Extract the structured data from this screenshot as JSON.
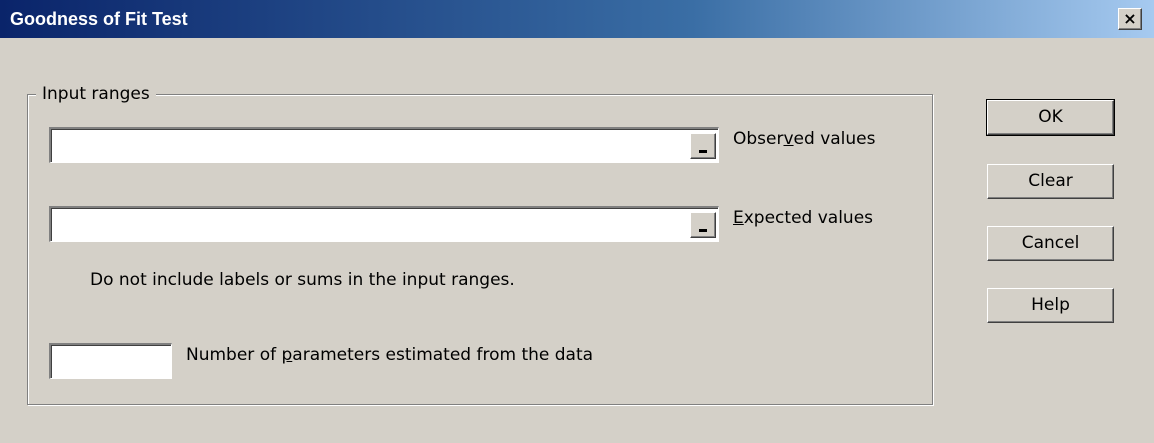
{
  "window": {
    "title": "Goodness of Fit Test",
    "close_label": "×"
  },
  "group": {
    "label": "Input ranges"
  },
  "observed": {
    "value": "",
    "label_pre": "Obser",
    "label_accel": "v",
    "label_post": "ed values"
  },
  "expected": {
    "value": "",
    "label_pre": "",
    "label_accel": "E",
    "label_post": "xpected values"
  },
  "note": "Do not include labels or sums in the input ranges.",
  "params": {
    "value": "",
    "label_pre": "Number of ",
    "label_accel": "p",
    "label_post": "arameters estimated from the data"
  },
  "buttons": {
    "ok": "OK",
    "clear": "Clear",
    "cancel": "Cancel",
    "help": "Help"
  },
  "icons": {
    "close": "close-icon",
    "range_select": "collapse-dialog-icon"
  },
  "colors": {
    "title_start": "#0a246a",
    "title_end": "#a6caf0",
    "face": "#d4d0c8"
  }
}
